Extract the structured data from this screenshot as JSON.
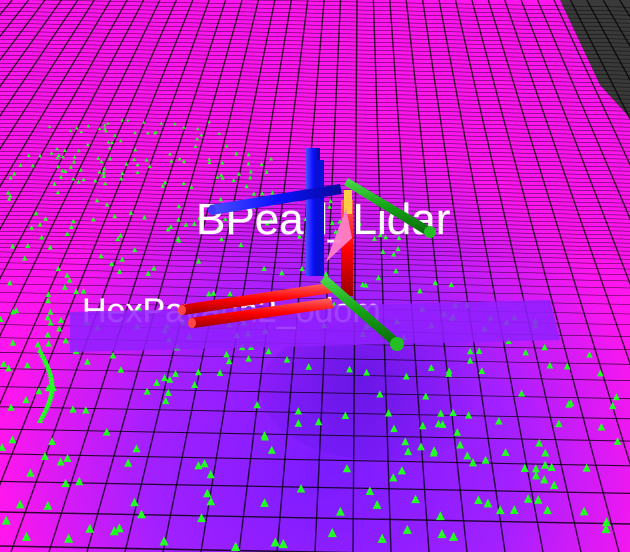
{
  "scene": {
    "labels": {
      "frame_label": "BPearl_Lidar",
      "frame_label_2": "HexPavann2_odom"
    },
    "colors": {
      "background": "#3a3a3a",
      "ground_far": "#ff16ee",
      "ground_near": "#8e22ff",
      "ground_shadow": "#5a14d8",
      "grid_line": "#000000",
      "points": "#22ff22",
      "axis_x": "#ff0000",
      "axis_y": "#13a313",
      "axis_z": "#0b12ff"
    },
    "icons": {
      "axes": "rgb-coordinate-frame-icon",
      "pointcloud": "green-arrow-markers"
    }
  }
}
